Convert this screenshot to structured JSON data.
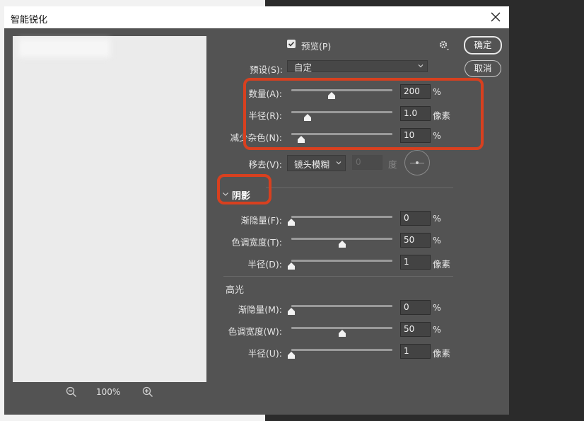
{
  "dialog": {
    "title": "智能锐化",
    "ok_label": "确定",
    "cancel_label": "取消",
    "preview_label": "预览(P)",
    "preview_checked": true
  },
  "preview_pane": {
    "zoom": "100%"
  },
  "preset": {
    "label": "预设(S):",
    "value": "自定"
  },
  "sliders": {
    "amount": {
      "label": "数量(A):",
      "value": "200",
      "unit": "%",
      "level": 0.4
    },
    "radius": {
      "label": "半径(R):",
      "value": "1.0",
      "unit": "像素",
      "level": 0.16
    },
    "noise": {
      "label": "减少杂色(N):",
      "value": "10",
      "unit": "%",
      "level": 0.1
    }
  },
  "remove": {
    "label": "移去(V):",
    "value": "镜头模糊",
    "angle": "0",
    "angle_unit": "度"
  },
  "shadows": {
    "title": "阴影",
    "fade": {
      "label": "渐隐量(F):",
      "value": "0",
      "unit": "%",
      "level": 0.0
    },
    "tonal": {
      "label": "色调宽度(T):",
      "value": "50",
      "unit": "%",
      "level": 0.5
    },
    "radius": {
      "label": "半径(D):",
      "value": "1",
      "unit": "像素",
      "level": 0.0
    }
  },
  "highlights": {
    "title": "高光",
    "fade": {
      "label": "渐隐量(M):",
      "value": "0",
      "unit": "%",
      "level": 0.0
    },
    "tonal": {
      "label": "色调宽度(W):",
      "value": "50",
      "unit": "%",
      "level": 0.5
    },
    "radius": {
      "label": "半径(U):",
      "value": "1",
      "unit": "像素",
      "level": 0.0
    }
  },
  "colors": {
    "highlight_box": "#d8401f",
    "dialog_bg": "#535353"
  }
}
